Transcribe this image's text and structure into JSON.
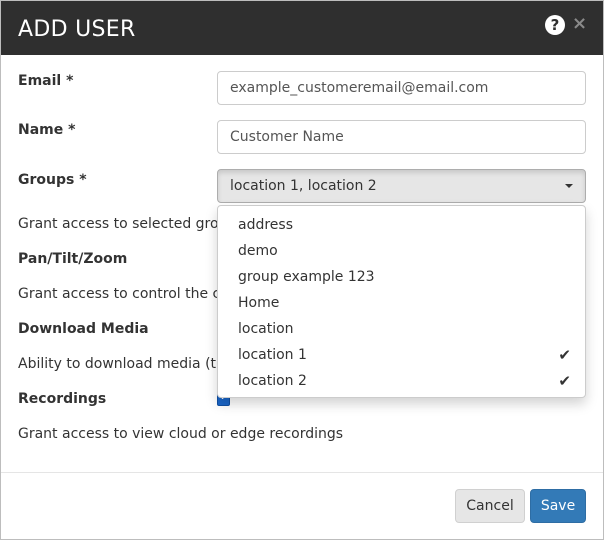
{
  "dialog": {
    "title": "ADD USER"
  },
  "icons": {
    "help": "question-circle-icon",
    "close": "close-icon",
    "caret": "caret-down-icon",
    "check": "checkmark-icon"
  },
  "form": {
    "email": {
      "label": "Email *",
      "value": "example_customeremail@email.com"
    },
    "name": {
      "label": "Name *",
      "value": "Customer Name"
    },
    "groups": {
      "label": "Groups *",
      "value": "location 1, location 2",
      "hint": "Grant access to selected group",
      "options": [
        {
          "label": "address",
          "checked": false
        },
        {
          "label": "demo",
          "checked": false
        },
        {
          "label": "group example 123",
          "checked": false
        },
        {
          "label": "Home",
          "checked": false
        },
        {
          "label": "location",
          "checked": false
        },
        {
          "label": "location 1",
          "checked": true
        },
        {
          "label": "location 2",
          "checked": true
        }
      ]
    },
    "ptz": {
      "label": "Pan/Tilt/Zoom",
      "hint": "Grant access to control the cam"
    },
    "download": {
      "label": "Download Media",
      "hint": "Ability to download media (tim"
    },
    "recordings": {
      "label": "Recordings",
      "hint": "Grant access to view cloud or edge recordings",
      "checked": true
    }
  },
  "footer": {
    "cancel_label": "Cancel",
    "save_label": "Save"
  },
  "colors": {
    "header_bg": "#2f2f2f",
    "primary": "#337ab7",
    "checkbox": "#1a66c9"
  }
}
